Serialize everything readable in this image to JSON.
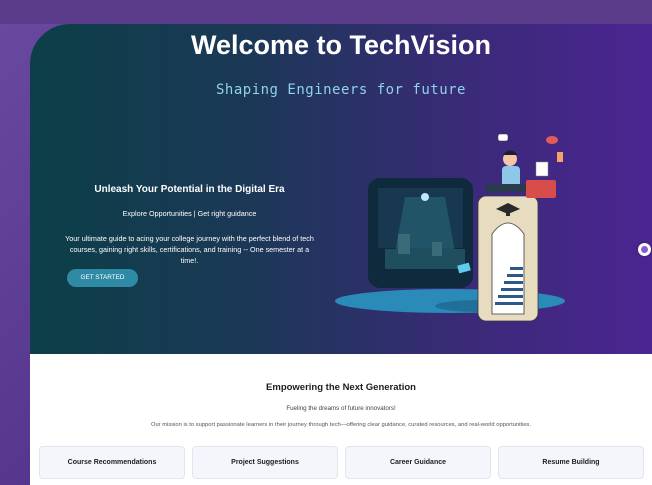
{
  "hero": {
    "title": "Welcome to TechVision",
    "subtitle": "Shaping Engineers for future",
    "heading": "Unleash Your Potential in the Digital Era",
    "tagline": "Explore Opportunities | Get right guidance",
    "description": "Your ultimate guide to acing your college journey with the perfect blend of tech courses, gaining right skills, certifications, and training -- One semester at a time!.",
    "cta_label": "GET STARTED"
  },
  "mission": {
    "title": "Empowering the Next Generation",
    "subtitle": "Fueling the dreams of future innovators!",
    "description": "Our mission is to support passionate learners in their journey through tech—offering clear guidance, curated resources, and real-world opportunities.",
    "cards": [
      {
        "label": "Course Recommendations"
      },
      {
        "label": "Project Suggestions"
      },
      {
        "label": "Career Guidance"
      },
      {
        "label": "Resume Building"
      }
    ]
  },
  "colors": {
    "hero_gradient_start": "#0c3f48",
    "hero_gradient_end": "#4b2591",
    "accent": "#2f8aa6",
    "subtitle": "#8fd3e8"
  }
}
